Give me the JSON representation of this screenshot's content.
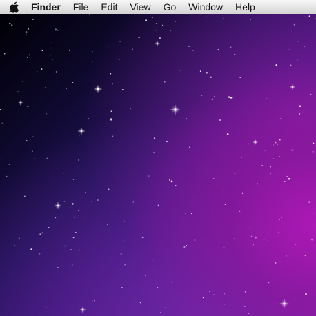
{
  "menubar": {
    "apple_icon": "apple-logo-icon",
    "app_name": "Finder",
    "menus": [
      "File",
      "Edit",
      "View",
      "Go",
      "Window",
      "Help"
    ]
  },
  "desktop": {
    "wallpaper": "purple-starfield",
    "colors": {
      "dark_corner": "#000005",
      "deep_blue": "#1f1255",
      "purple": "#5c1a8a",
      "magenta": "#b018b6"
    }
  }
}
